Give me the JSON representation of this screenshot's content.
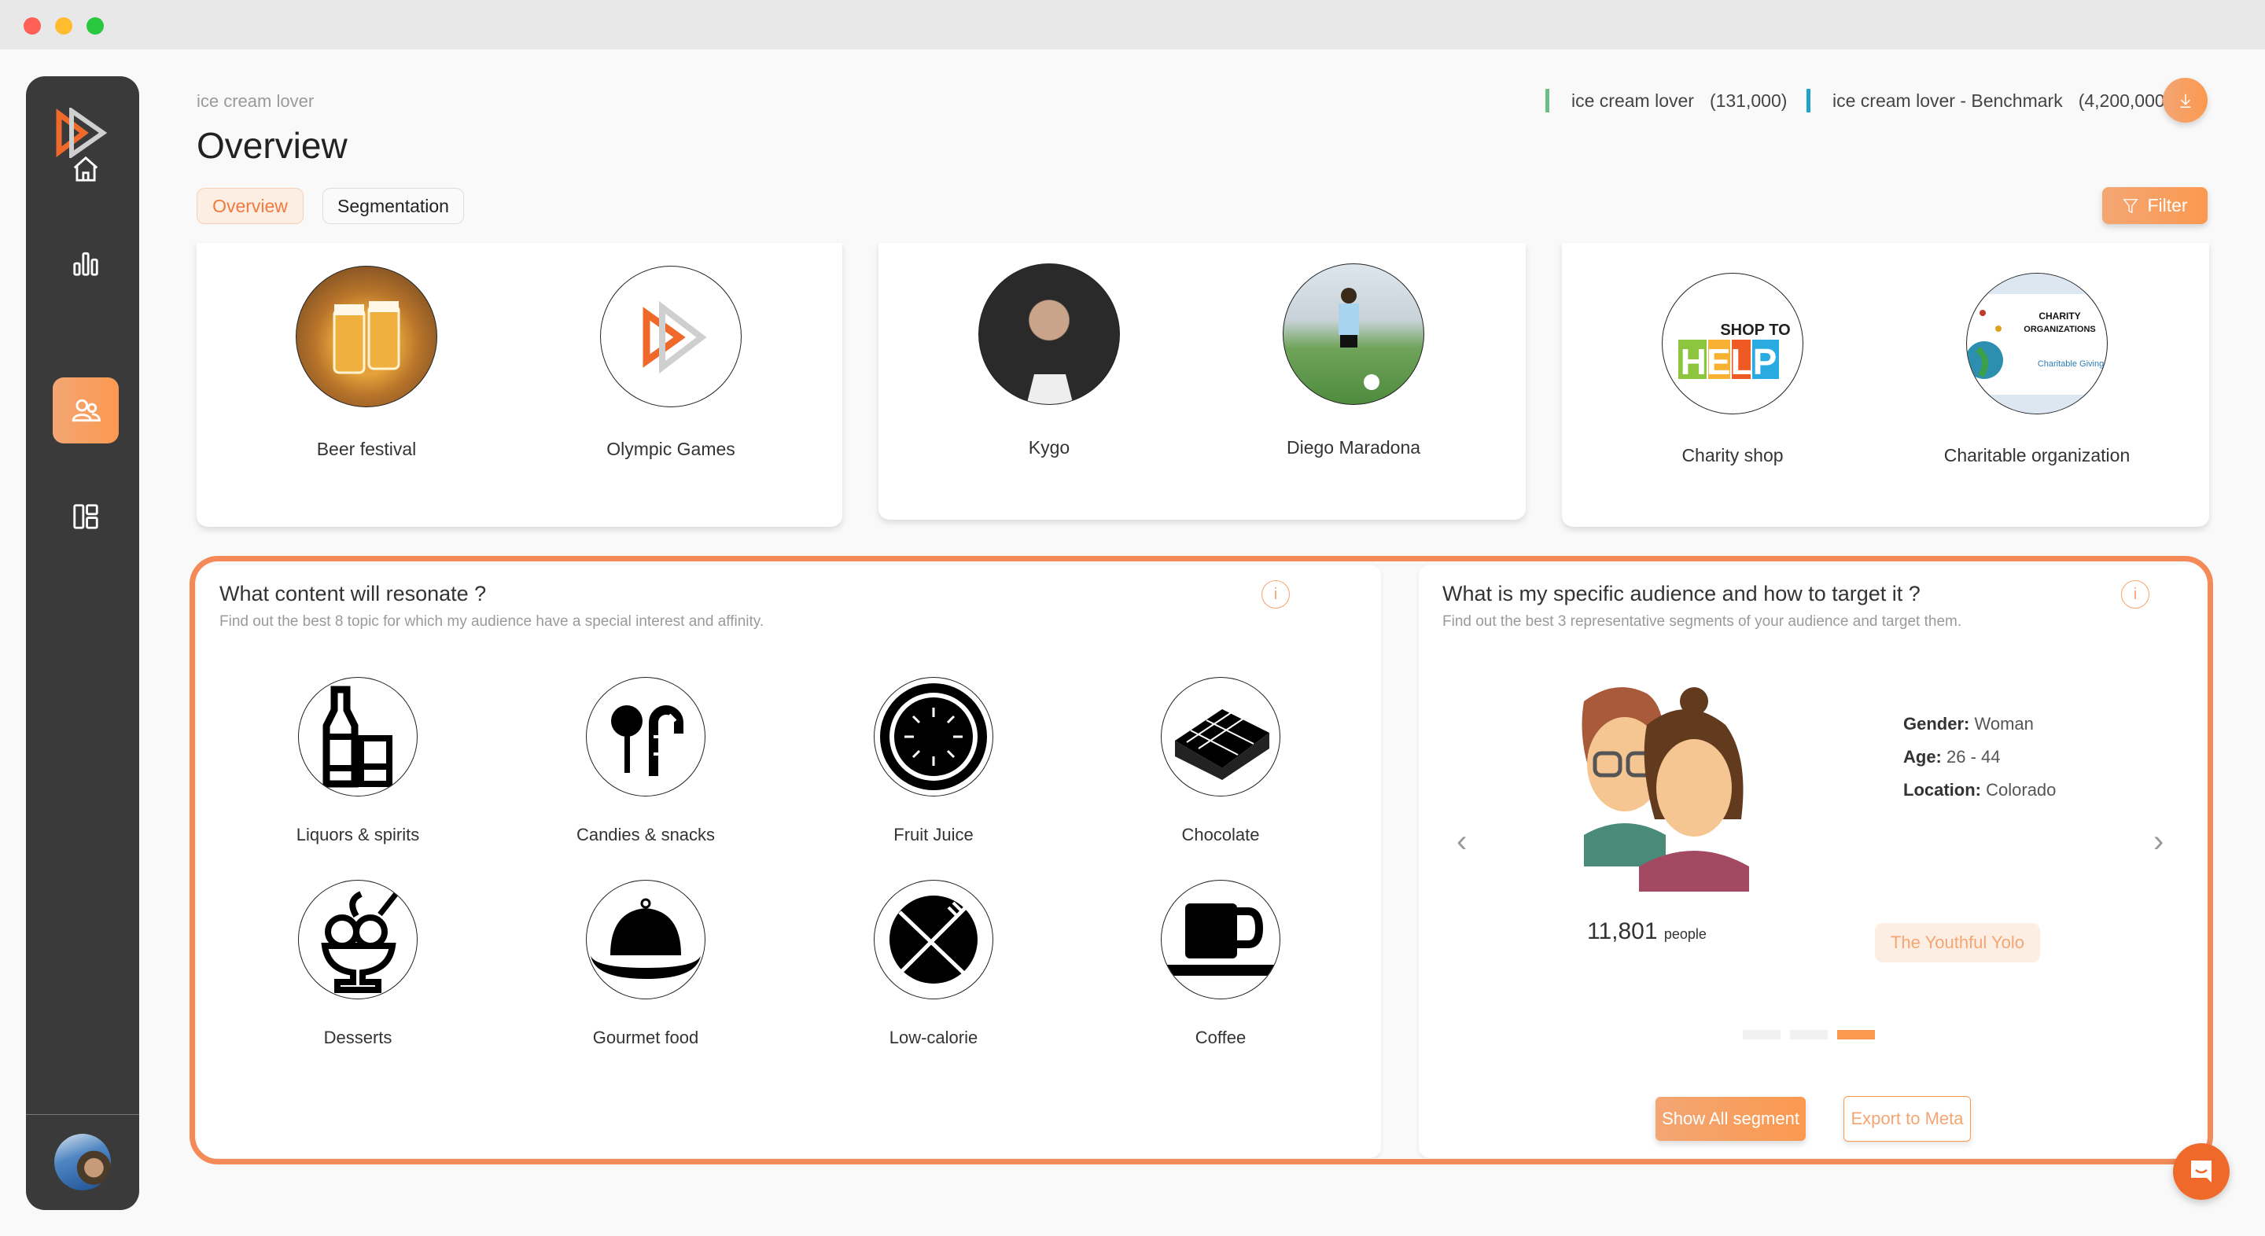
{
  "window": {
    "controls": [
      "close",
      "minimize",
      "maximize"
    ]
  },
  "sidebar": {
    "items": [
      {
        "name": "home",
        "icon": "home-icon",
        "active": false
      },
      {
        "name": "analytics",
        "icon": "bar-chart-icon",
        "active": false
      },
      {
        "name": "audience",
        "icon": "users-icon",
        "active": true
      },
      {
        "name": "dashboard",
        "icon": "layout-icon",
        "active": false
      }
    ]
  },
  "header": {
    "breadcrumb": "ice cream lover",
    "title": "Overview",
    "tabs": [
      {
        "label": "Overview",
        "active": true
      },
      {
        "label": "Segmentation",
        "active": false
      }
    ],
    "legend": [
      {
        "label": "ice cream lover",
        "count": "(131,000)",
        "color": "#6cbf84"
      },
      {
        "label": "ice cream lover - Benchmark",
        "count": "(4,200,000)",
        "color": "#1fa3c8"
      }
    ],
    "filter_label": "Filter"
  },
  "top_cards": [
    {
      "items": [
        {
          "label": "Beer festival",
          "image": "beer-photo"
        },
        {
          "label": "Olympic Games",
          "image": "brand-logo"
        }
      ]
    },
    {
      "items": [
        {
          "label": "Kygo",
          "image": "person-photo"
        },
        {
          "label": "Diego Maradona",
          "image": "footballer-photo"
        }
      ]
    },
    {
      "items": [
        {
          "label": "Charity shop",
          "image": "shop-to-help-logo"
        },
        {
          "label": "Charitable organization",
          "image": "charity-organizations-logo"
        }
      ]
    }
  ],
  "content_panel": {
    "title": "What content will resonate ?",
    "subtitle": "Find out the best 8 topic for which my audience have a special interest and affinity.",
    "info": "i",
    "topics": [
      {
        "label": "Liquors & spirits",
        "icon": "liquor-icon"
      },
      {
        "label": "Candies & snacks",
        "icon": "candy-icon"
      },
      {
        "label": "Fruit Juice",
        "icon": "citrus-icon"
      },
      {
        "label": "Chocolate",
        "icon": "chocolate-icon"
      },
      {
        "label": "Desserts",
        "icon": "sundae-icon"
      },
      {
        "label": "Gourmet food",
        "icon": "cloche-icon"
      },
      {
        "label": "Low-calorie",
        "icon": "no-food-icon"
      },
      {
        "label": "Coffee",
        "icon": "coffee-cup-icon"
      }
    ]
  },
  "audience_panel": {
    "title": "What is my specific audience and how to target it ?",
    "subtitle": "Find out the best 3 representative segments of your audience and target them.",
    "info": "i",
    "attributes": [
      {
        "key": "Gender:",
        "value": "Woman"
      },
      {
        "key": "Age:",
        "value": "26 - 44"
      },
      {
        "key": "Location:",
        "value": "Colorado"
      }
    ],
    "count": "11,801",
    "count_unit": "people",
    "segment_name": "The Youthful Yolo",
    "pagination": {
      "total": 3,
      "active": 3
    },
    "show_all_label": "Show All segment",
    "export_label": "Export to Meta",
    "prev": "‹",
    "next": "›"
  },
  "colors": {
    "accent": "#fb9950",
    "highlight": "#f38a57",
    "sidebar": "#3a3a3a",
    "chat": "#ef6a2a"
  }
}
